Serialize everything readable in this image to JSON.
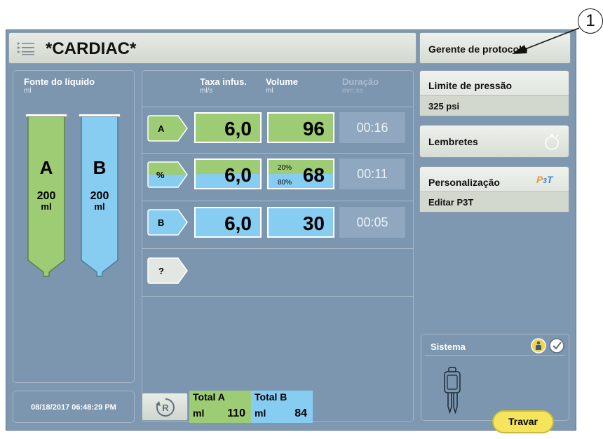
{
  "header": {
    "title": "*CARDIAC*",
    "protocol_button": "Gerente de protocolo"
  },
  "callout": "1",
  "fluid_source": {
    "title": "Fonte do líquido",
    "unit": "ml",
    "bottles": [
      {
        "letter": "A",
        "volume": "200",
        "unit": "ml",
        "color": "#9dcc74"
      },
      {
        "letter": "B",
        "volume": "200",
        "unit": "ml",
        "color": "#87cdf1"
      }
    ]
  },
  "columns": {
    "rate": {
      "label": "Taxa infus.",
      "unit": "ml/s"
    },
    "volume": {
      "label": "Volume",
      "unit": "ml"
    },
    "duration": {
      "label": "Duração",
      "unit": "mm:ss"
    }
  },
  "rows": [
    {
      "label": "A",
      "rate": "6,0",
      "volume": "96",
      "duration": "00:16"
    },
    {
      "label": "%",
      "rate": "6,0",
      "volume": "68",
      "pct_top": "20%",
      "pct_bottom": "80%",
      "duration": "00:11"
    },
    {
      "label": "B",
      "rate": "6,0",
      "volume": "30",
      "duration": "00:05"
    },
    {
      "label": "?"
    }
  ],
  "right_panel": {
    "pressure_limit": {
      "label": "Limite de pressão",
      "value": "325 psi"
    },
    "reminders": {
      "label": "Lembretes"
    },
    "customization": {
      "label": "Personalização",
      "badge": "P3T",
      "sub": "Editar P3T"
    },
    "system": {
      "label": "Sistema"
    }
  },
  "footer": {
    "datetime": "08/18/2017 06:48:29 PM",
    "reset_icon": "R",
    "total_a": {
      "label": "Total A",
      "unit": "ml",
      "value": "110"
    },
    "total_b": {
      "label": "Total B",
      "unit": "ml",
      "value": "84"
    },
    "lock_button": "Travar"
  },
  "colors": {
    "contrast_a": "#9dcc74",
    "saline_b": "#87cdf1",
    "background": "#7f98b2",
    "lock": "#f5e45c"
  }
}
